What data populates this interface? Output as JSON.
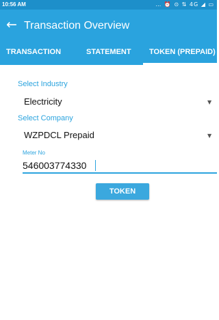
{
  "status_bar": {
    "time": "10:56 AM",
    "icons": "… ⏰ ⊙ ⇅ 4G ◢ ▭"
  },
  "header": {
    "back_icon": "←",
    "title": "Transaction Overview"
  },
  "tabs": [
    {
      "label": "TRANSACTION",
      "active": false
    },
    {
      "label": "STATEMENT",
      "active": false
    },
    {
      "label": "TOKEN (PREPAID)",
      "active": true
    }
  ],
  "form": {
    "industry_label": "Select Industry",
    "industry_value": "Electricity",
    "company_label": "Select Company",
    "company_value": "WZPDCL Prepaid",
    "meter_label": "Meter No",
    "meter_value": "546003774330",
    "submit_label": "TOKEN",
    "dropdown_icon": "▼"
  },
  "colors": {
    "primary": "#2aa3de",
    "status_bar": "#1d8fca",
    "text": "#111111"
  }
}
